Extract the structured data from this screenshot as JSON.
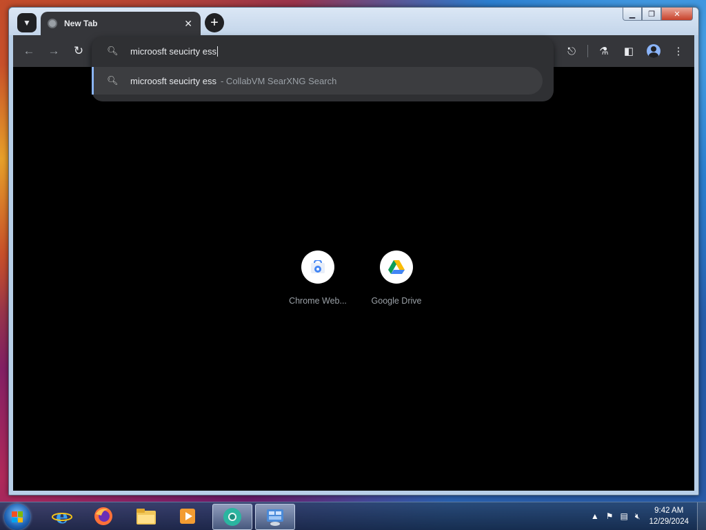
{
  "browser": {
    "tab": {
      "title": "New Tab"
    },
    "omnibox": {
      "value": "microosft seucirty ess",
      "suggestion": {
        "text": "microosft seucirty ess",
        "source": "- CollabVM SearXNG Search"
      }
    },
    "shortcuts": [
      {
        "label": "Chrome Web...",
        "icon": "chrome-web-store-icon"
      },
      {
        "label": "Google Drive",
        "icon": "google-drive-icon"
      }
    ]
  },
  "taskbar": {
    "items": [
      "internet-explorer-icon",
      "firefox-icon",
      "file-explorer-icon",
      "media-player-icon",
      "chrome-canary-icon",
      "control-panel-icon"
    ],
    "clock": {
      "time": "9:42 AM",
      "date": "12/29/2024"
    }
  },
  "colors": {
    "accent": "#8ab4f8",
    "toolbar": "#35363a",
    "content": "#000000"
  }
}
